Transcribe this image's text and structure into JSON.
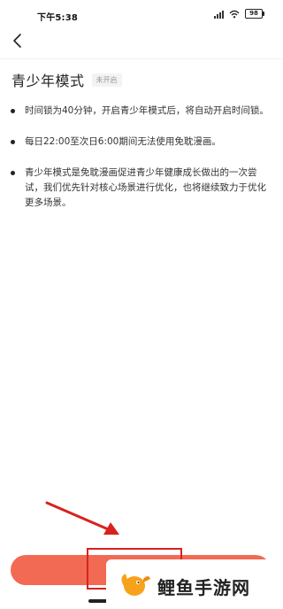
{
  "status_bar": {
    "time": "下午5:38",
    "battery": "98"
  },
  "page": {
    "title": "青少年模式",
    "status_badge": "未开启"
  },
  "info_items": [
    {
      "text": "时间锁为40分钟，开启青少年模式后，将自动开启时间锁。"
    },
    {
      "text": "每日22:00至次日6:00期间无法使用免耽漫画。"
    },
    {
      "text": "青少年模式是免耽漫画促进青少年健康成长做出的一次尝试，我们优先针对核心场景进行优化，也将继续致力于优化更多场景。"
    }
  ],
  "watermark": {
    "text": "鲤鱼手游网"
  },
  "colors": {
    "accent": "#f26a53",
    "annotation": "#d8221f"
  },
  "icons": [
    "back-icon",
    "signal-icon",
    "wifi-icon",
    "battery-icon",
    "fish-logo-icon"
  ]
}
